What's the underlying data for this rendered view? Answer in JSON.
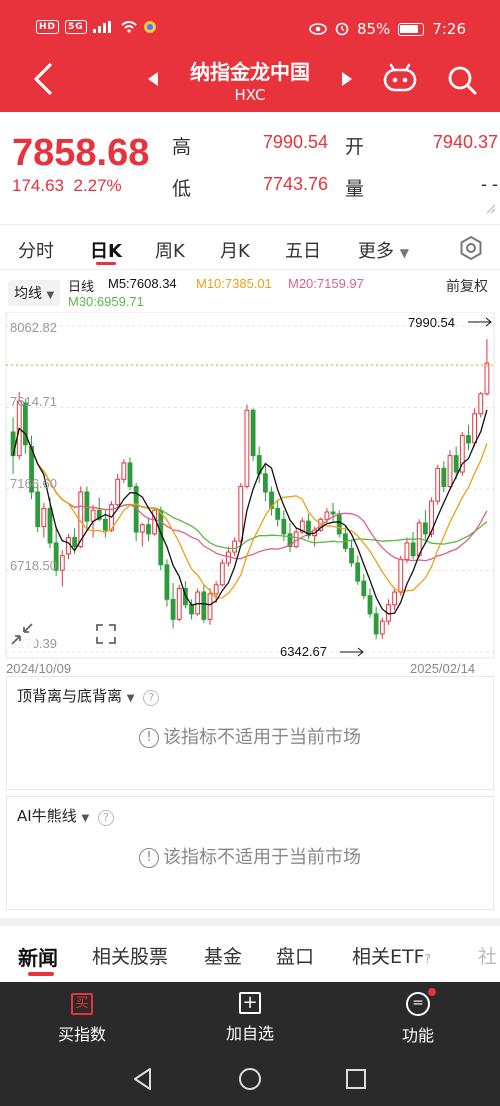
{
  "status_bar": {
    "left_chips": [
      "HD",
      "5G"
    ],
    "battery": "85%",
    "time": "7:26"
  },
  "header": {
    "title": "纳指金龙中国",
    "subtitle": "HXC"
  },
  "quote": {
    "price": "7858.68",
    "change": "174.63",
    "change_pct": "2.27%",
    "high_label": "高",
    "high": "7990.54",
    "open_label": "开",
    "open": "7940.37",
    "low_label": "低",
    "low": "7743.76",
    "volume_label": "量",
    "volume": "- -"
  },
  "tabs": [
    "分时",
    "日K",
    "周K",
    "月K",
    "五日",
    "更多"
  ],
  "ma_legend": {
    "selector": "均线",
    "type": "日线",
    "ma5": "M5:7608.34",
    "ma10": "M10:7385.01",
    "ma20": "M20:7159.97",
    "ma30": "M30:6959.71",
    "adjust": "前复权"
  },
  "colors": {
    "brand_red": "#e8323c",
    "up": "#e8323c",
    "down": "#2d9b3a",
    "ma5": "#111111",
    "ma10": "#e8a317",
    "ma20": "#e06088",
    "ma30": "#5cb845"
  },
  "chart_data": {
    "type": "candlestick",
    "y_ticks": [
      "8062.82",
      "7614.71",
      "7166.60",
      "6718.50",
      "6270.39"
    ],
    "ylim": [
      6270.39,
      8062.82
    ],
    "x_start": "2024/10/09",
    "x_end": "2025/02/14",
    "max_annotation": "7990.54",
    "min_annotation": "6342.67",
    "candles": [
      [
        7480,
        7560,
        7250,
        7350
      ],
      [
        7350,
        7700,
        7330,
        7650
      ],
      [
        7640,
        7660,
        7360,
        7410
      ],
      [
        7400,
        7460,
        7110,
        7150
      ],
      [
        7150,
        7200,
        6930,
        6960
      ],
      [
        6960,
        7090,
        6900,
        7060
      ],
      [
        7060,
        7120,
        6840,
        6870
      ],
      [
        6870,
        6960,
        6690,
        6720
      ],
      [
        6720,
        6830,
        6630,
        6800
      ],
      [
        6810,
        6920,
        6780,
        6900
      ],
      [
        6900,
        6950,
        6810,
        6850
      ],
      [
        6850,
        7180,
        6840,
        7150
      ],
      [
        7150,
        7180,
        6950,
        6990
      ],
      [
        6990,
        7080,
        6900,
        7050
      ],
      [
        7050,
        7120,
        6990,
        7000
      ],
      [
        7000,
        7050,
        6900,
        6940
      ],
      [
        6940,
        7100,
        6930,
        7080
      ],
      [
        7080,
        7250,
        7070,
        7220
      ],
      [
        7220,
        7330,
        7200,
        7310
      ],
      [
        7310,
        7340,
        7160,
        7180
      ],
      [
        7180,
        7200,
        6880,
        6930
      ],
      [
        6930,
        6980,
        6850,
        6970
      ],
      [
        6970,
        7010,
        6880,
        6920
      ],
      [
        6920,
        7060,
        6910,
        7050
      ],
      [
        7050,
        7070,
        6720,
        6750
      ],
      [
        6750,
        6780,
        6520,
        6560
      ],
      [
        6560,
        6650,
        6400,
        6450
      ],
      [
        6450,
        6640,
        6440,
        6620
      ],
      [
        6620,
        6660,
        6510,
        6530
      ],
      [
        6530,
        6560,
        6450,
        6480
      ],
      [
        6480,
        6620,
        6470,
        6600
      ],
      [
        6600,
        6640,
        6430,
        6450
      ],
      [
        6450,
        6620,
        6420,
        6590
      ],
      [
        6590,
        6660,
        6540,
        6640
      ],
      [
        6640,
        6780,
        6630,
        6760
      ],
      [
        6760,
        6850,
        6740,
        6820
      ],
      [
        6820,
        6900,
        6800,
        6880
      ],
      [
        6880,
        7200,
        6870,
        7180
      ],
      [
        7180,
        7630,
        7170,
        7600
      ],
      [
        7600,
        7610,
        7320,
        7350
      ],
      [
        7350,
        7400,
        7200,
        7250
      ],
      [
        7250,
        7300,
        7100,
        7150
      ],
      [
        7150,
        7180,
        7020,
        7060
      ],
      [
        7060,
        7110,
        6960,
        7000
      ],
      [
        7000,
        7050,
        6880,
        6920
      ],
      [
        6920,
        6980,
        6820,
        6850
      ],
      [
        6850,
        6950,
        6840,
        6930
      ],
      [
        6930,
        7010,
        6920,
        6990
      ],
      [
        6990,
        7030,
        6890,
        6910
      ],
      [
        6910,
        6960,
        6850,
        6940
      ],
      [
        6940,
        7010,
        6930,
        7000
      ],
      [
        7000,
        7060,
        6980,
        7040
      ],
      [
        7040,
        7090,
        6990,
        7030
      ],
      [
        7030,
        7050,
        6900,
        6920
      ],
      [
        6920,
        6960,
        6820,
        6840
      ],
      [
        6840,
        6890,
        6740,
        6760
      ],
      [
        6760,
        6800,
        6640,
        6660
      ],
      [
        6660,
        6700,
        6560,
        6580
      ],
      [
        6580,
        6620,
        6460,
        6480
      ],
      [
        6480,
        6520,
        6340,
        6370
      ],
      [
        6370,
        6460,
        6342.67,
        6440
      ],
      [
        6440,
        6560,
        6420,
        6530
      ],
      [
        6530,
        6620,
        6500,
        6600
      ],
      [
        6600,
        6800,
        6580,
        6780
      ],
      [
        6780,
        6900,
        6760,
        6870
      ],
      [
        6870,
        6930,
        6780,
        6800
      ],
      [
        6800,
        7000,
        6790,
        6980
      ],
      [
        6980,
        7050,
        6890,
        6920
      ],
      [
        6920,
        7120,
        6900,
        7100
      ],
      [
        7100,
        7300,
        7080,
        7280
      ],
      [
        7280,
        7320,
        7150,
        7180
      ],
      [
        7180,
        7380,
        7160,
        7350
      ],
      [
        7350,
        7400,
        7220,
        7260
      ],
      [
        7260,
        7480,
        7240,
        7460
      ],
      [
        7460,
        7520,
        7380,
        7420
      ],
      [
        7420,
        7610,
        7400,
        7580
      ],
      [
        7580,
        7700,
        7560,
        7690
      ],
      [
        7690,
        7990.54,
        7680,
        7858.68
      ]
    ]
  },
  "panel1": {
    "dropdown": "顶背离与底背离",
    "message": "该指标不适用于当前市场"
  },
  "panel2": {
    "dropdown": "AI牛熊线",
    "message": "该指标不适用于当前市场"
  },
  "news_tabs": [
    "新闻",
    "相关股票",
    "基金",
    "盘口",
    "相关ETF",
    "社"
  ],
  "bottom_bar": {
    "buy_icon": "买",
    "buy": "买指数",
    "add": "加自选",
    "func": "功能"
  }
}
